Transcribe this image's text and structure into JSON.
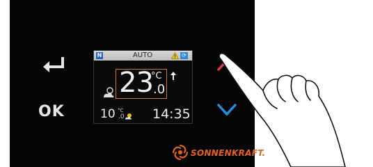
{
  "buttons": {
    "ok_label": "OK"
  },
  "display": {
    "status": {
      "n_badge": "N",
      "mode": "AUTO"
    },
    "temperature": {
      "integer": "23",
      "unit": "°C",
      "decimal": ".0"
    },
    "outdoor": {
      "integer": "10",
      "unit": "°C",
      "decimal": ".0"
    },
    "clock": "14:35"
  },
  "brand": {
    "name": "SONNENKRAFT."
  },
  "colors": {
    "up_arrow": "#e0374a",
    "down_arrow": "#1f8fe0",
    "temp_frame": "#d0782c",
    "brand": "#e8611a",
    "warning": "#f2c200"
  },
  "icons": [
    "back-arrow-icon",
    "up-chevron-icon",
    "down-chevron-icon",
    "warning-icon",
    "sync-icon",
    "trend-up-icon",
    "weather-icon",
    "sun-cloud-icon",
    "sonnenkraft-logo-icon",
    "hand-icon"
  ]
}
